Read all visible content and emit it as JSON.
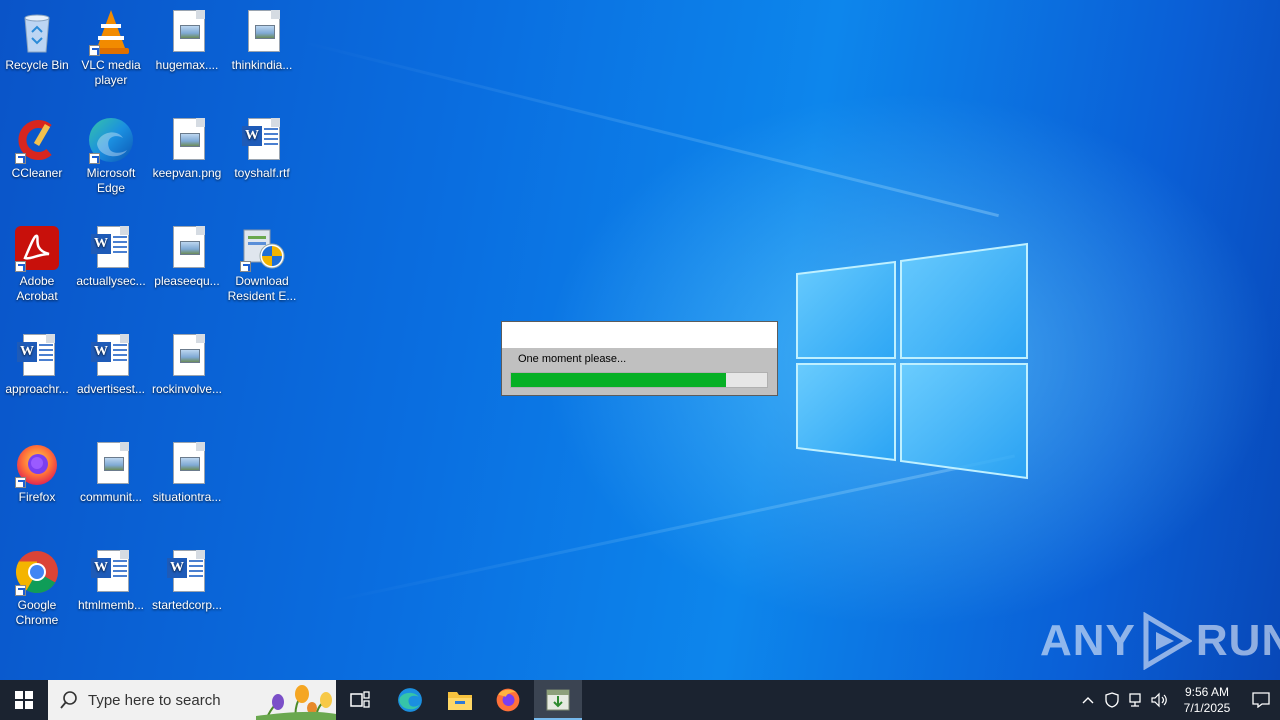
{
  "desktop": {
    "icons": [
      {
        "label": "Recycle Bin"
      },
      {
        "label": "VLC media player"
      },
      {
        "label": "hugemax...."
      },
      {
        "label": "thinkindia..."
      },
      {
        "label": "CCleaner"
      },
      {
        "label": "Microsoft Edge"
      },
      {
        "label": "keepvan.png"
      },
      {
        "label": "toyshalf.rtf"
      },
      {
        "label": "Adobe Acrobat"
      },
      {
        "label": "actuallysec..."
      },
      {
        "label": "pleaseequ..."
      },
      {
        "label": "Download Resident E..."
      },
      {
        "label": "approachr..."
      },
      {
        "label": "advertisest..."
      },
      {
        "label": "rockinvolve..."
      },
      {
        "label": "Firefox"
      },
      {
        "label": "communit..."
      },
      {
        "label": "situationtra..."
      },
      {
        "label": "Google Chrome"
      },
      {
        "label": "htmlmemb..."
      },
      {
        "label": "startedcorp..."
      }
    ]
  },
  "dialog": {
    "message": "One moment please...",
    "progress_fraction": 0.84,
    "progress_color": "#06b025"
  },
  "watermark": {
    "left": "ANY",
    "right": "RUN"
  },
  "taskbar": {
    "start_icon": "windows-start-icon",
    "search_placeholder": "Type here to search",
    "pinned": [
      "task-view-icon",
      "edge-icon",
      "file-explorer-icon",
      "firefox-icon",
      "installer-app-icon"
    ],
    "clock_time": "9:56 AM",
    "clock_date": "7/1/2025"
  },
  "colors": {
    "accent": "#0a6ee0",
    "taskbar": "#1b2330"
  }
}
